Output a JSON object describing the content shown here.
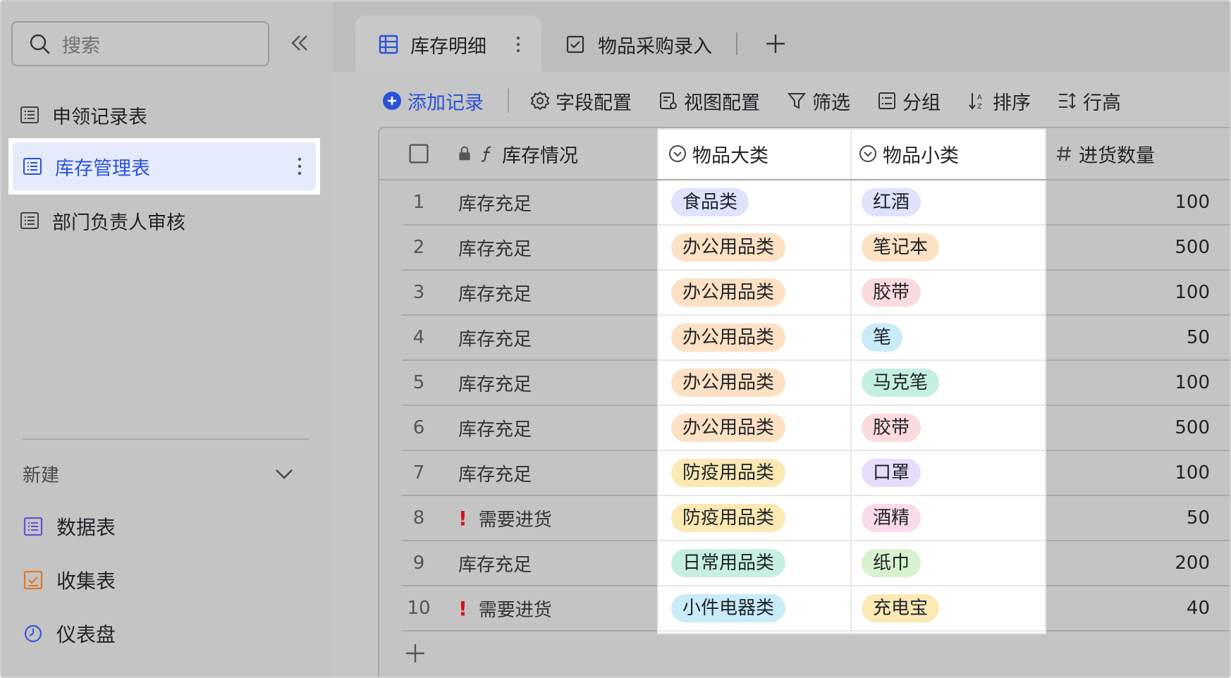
{
  "sidebar": {
    "search_placeholder": "搜索",
    "tables": [
      {
        "label": "申领记录表"
      },
      {
        "label": "库存管理表"
      },
      {
        "label": "部门负责人审核"
      }
    ],
    "new_label": "新建",
    "create_items": [
      {
        "label": "数据表",
        "icon": "grid-table-icon",
        "color": "#6a4fd8"
      },
      {
        "label": "收集表",
        "icon": "form-check-icon",
        "color": "#e07a20"
      },
      {
        "label": "仪表盘",
        "icon": "dashboard-icon",
        "color": "#3a55d6"
      }
    ]
  },
  "tabs": {
    "active": "库存明细",
    "other": "物品采购录入"
  },
  "toolbar": {
    "add_record": "添加记录",
    "field_config": "字段配置",
    "view_config": "视图配置",
    "filter": "筛选",
    "group": "分组",
    "sort": "排序",
    "row_height": "行高"
  },
  "columns": {
    "status": "库存情况",
    "category": "物品大类",
    "subcategory": "物品小类",
    "quantity": "进货数量"
  },
  "rows": [
    {
      "n": "1",
      "status": "库存充足",
      "warn": false,
      "cat": "食品类",
      "cat_color": "#dfe3fb",
      "sub": "红酒",
      "sub_color": "#dfe3fb",
      "qty": "100"
    },
    {
      "n": "2",
      "status": "库存充足",
      "warn": false,
      "cat": "办公用品类",
      "cat_color": "#fde1c4",
      "sub": "笔记本",
      "sub_color": "#fde1c4",
      "qty": "500"
    },
    {
      "n": "3",
      "status": "库存充足",
      "warn": false,
      "cat": "办公用品类",
      "cat_color": "#fde1c4",
      "sub": "胶带",
      "sub_color": "#fbdbdd",
      "qty": "100"
    },
    {
      "n": "4",
      "status": "库存充足",
      "warn": false,
      "cat": "办公用品类",
      "cat_color": "#fde1c4",
      "sub": "笔",
      "sub_color": "#c9ecf8",
      "qty": "50"
    },
    {
      "n": "5",
      "status": "库存充足",
      "warn": false,
      "cat": "办公用品类",
      "cat_color": "#fde1c4",
      "sub": "马克笔",
      "sub_color": "#c6efe3",
      "qty": "100"
    },
    {
      "n": "6",
      "status": "库存充足",
      "warn": false,
      "cat": "办公用品类",
      "cat_color": "#fde1c4",
      "sub": "胶带",
      "sub_color": "#fbdbdd",
      "qty": "500"
    },
    {
      "n": "7",
      "status": "库存充足",
      "warn": false,
      "cat": "防疫用品类",
      "cat_color": "#fbe9b4",
      "sub": "口罩",
      "sub_color": "#e8dcfb",
      "qty": "100"
    },
    {
      "n": "8",
      "status": "需要进货",
      "warn": true,
      "cat": "防疫用品类",
      "cat_color": "#fbe9b4",
      "sub": "酒精",
      "sub_color": "#fbdbeb",
      "qty": "50"
    },
    {
      "n": "9",
      "status": "库存充足",
      "warn": false,
      "cat": "日常用品类",
      "cat_color": "#c6efe3",
      "sub": "纸巾",
      "sub_color": "#d8f2cf",
      "qty": "200"
    },
    {
      "n": "10",
      "status": "需要进货",
      "warn": true,
      "cat": "小件电器类",
      "cat_color": "#c9ecf8",
      "sub": "充电宝",
      "sub_color": "#fbe9b4",
      "qty": "40"
    }
  ],
  "colors": {
    "accent": "#2a52d6",
    "warning": "#d0101b"
  }
}
